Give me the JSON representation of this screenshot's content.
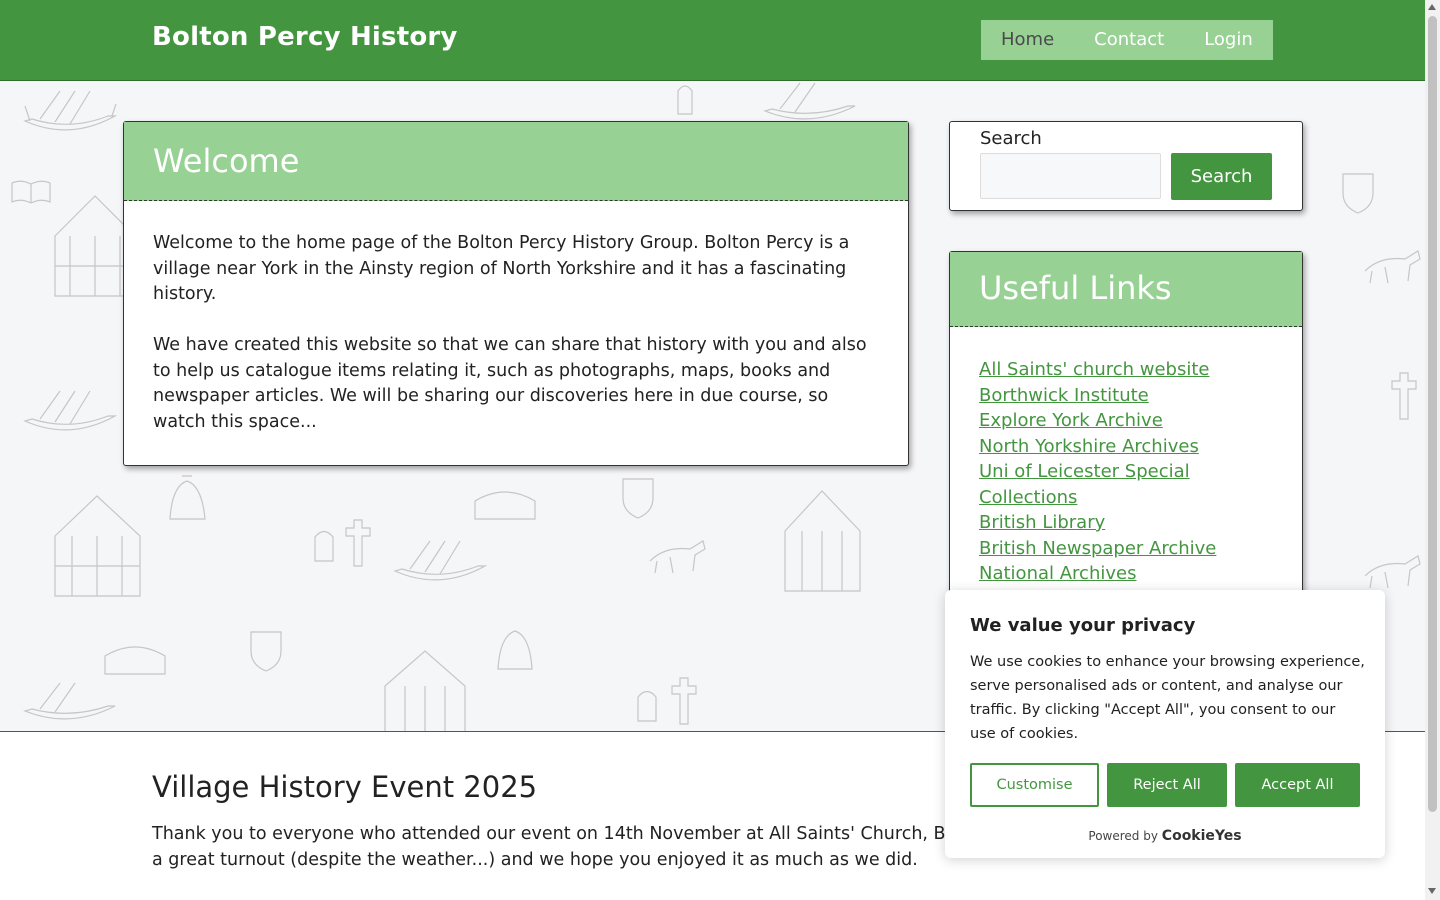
{
  "header": {
    "site_title": "Bolton Percy History",
    "nav": [
      {
        "label": "Home",
        "active": true
      },
      {
        "label": "Contact",
        "active": false
      },
      {
        "label": "Login",
        "active": false
      }
    ]
  },
  "welcome": {
    "title": "Welcome",
    "paragraphs": [
      "Welcome to the home page of the Bolton Percy History Group. Bolton Percy is a village near York in the Ainsty region of North Yorkshire and it has a fascinating history.",
      "We have created this website so that we can share that history with you and also to help us catalogue items relating it, such as photographs, maps, books and newspaper articles. We will be sharing our discoveries here in due course, so watch this space..."
    ]
  },
  "search": {
    "label": "Search",
    "input_value": "",
    "button_label": "Search"
  },
  "useful_links": {
    "title": "Useful Links",
    "items": [
      "All Saints' church website",
      "Borthwick Institute",
      "Explore York Archive",
      "North Yorkshire Archives",
      "Uni of Leicester Special Collections",
      "British Library",
      "British Newspaper Archive",
      "National Archives"
    ]
  },
  "event": {
    "title": "Village History Event 2025",
    "text": "Thank you to everyone who attended our event on 14th November at All Saints' Church, Bolt\na great turnout (despite the weather...) and we hope you enjoyed it as much as we did."
  },
  "cookie_banner": {
    "title": "We value your privacy",
    "description": "We use cookies to enhance your browsing experience, serve personalised ads or content, and analyse our traffic. By clicking \"Accept All\", you consent to our use of cookies.",
    "customise_label": "Customise",
    "reject_label": "Reject All",
    "accept_label": "Accept All",
    "powered_by": "Powered by",
    "brand": "CookieYes"
  },
  "colors": {
    "primary_green": "#43963f",
    "light_green": "#98d194",
    "hero_background": "#f5f6f8"
  }
}
